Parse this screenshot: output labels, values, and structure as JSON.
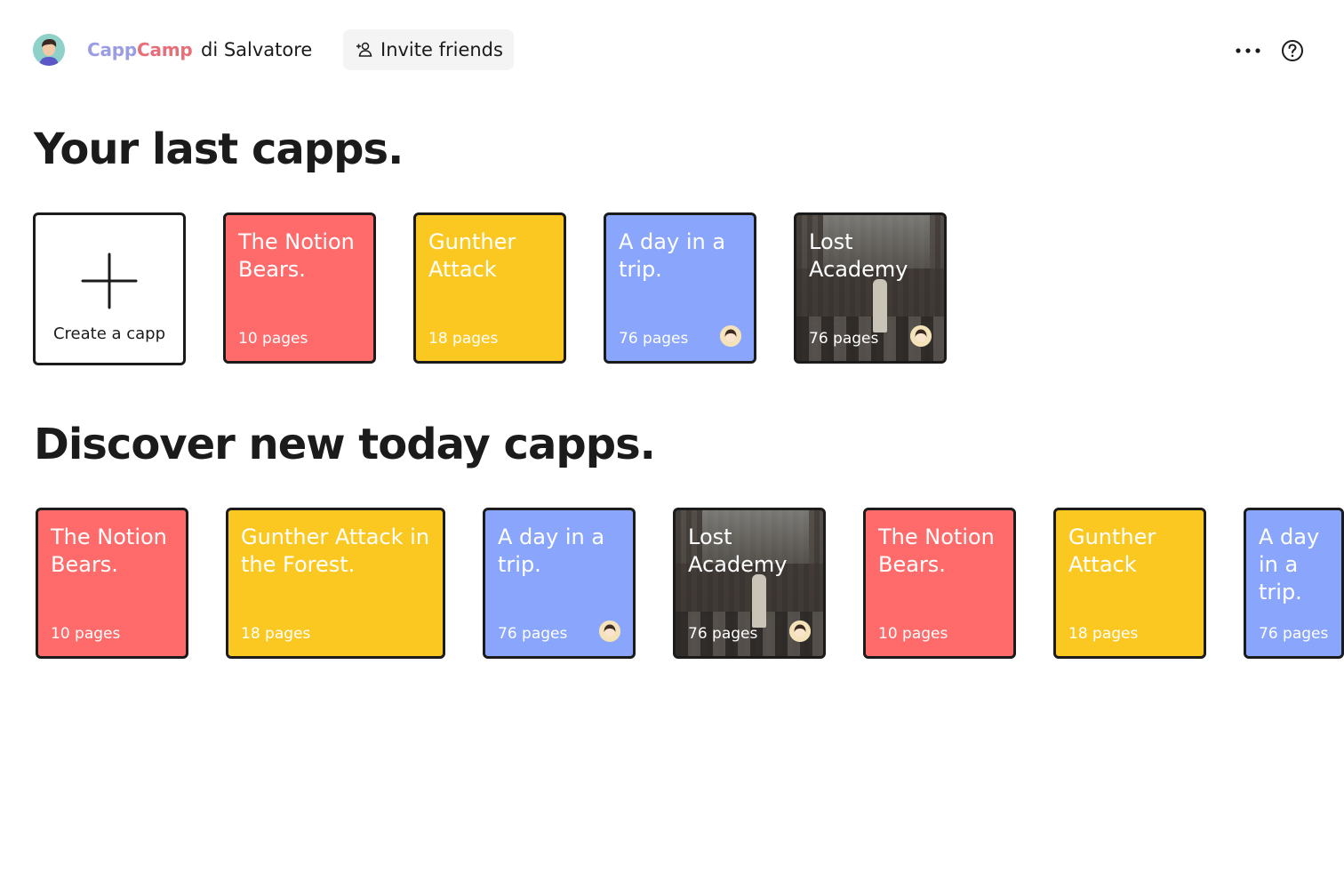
{
  "header": {
    "brand_part1": "Capp",
    "brand_part2": "Camp",
    "owner": "di Salvatore",
    "invite_label": "Invite friends"
  },
  "sections": {
    "last_title": "Your last capps.",
    "discover_title": "Discover new today capps."
  },
  "create_label": "Create a capp",
  "last_capps": [
    {
      "title": "The Notion Bears.",
      "pages": "10 pages",
      "style": "red",
      "has_avatar": false
    },
    {
      "title": "Gunther Attack",
      "pages": "18 pages",
      "style": "yellow",
      "has_avatar": false
    },
    {
      "title": "A day in a trip.",
      "pages": "76 pages",
      "style": "blue",
      "has_avatar": true
    },
    {
      "title": "Lost Academy",
      "pages": "76 pages",
      "style": "photo",
      "has_avatar": true
    }
  ],
  "discover_capps": [
    {
      "title": "The Notion Bears.",
      "pages": "10 pages",
      "style": "red",
      "has_avatar": false
    },
    {
      "title": "Gunther Attack in the Forest.",
      "pages": "18 pages",
      "style": "yellow",
      "has_avatar": false
    },
    {
      "title": "A day in a trip.",
      "pages": "76 pages",
      "style": "blue",
      "has_avatar": true
    },
    {
      "title": "Lost Academy",
      "pages": "76 pages",
      "style": "photo",
      "has_avatar": true
    },
    {
      "title": "The Notion Bears.",
      "pages": "10 pages",
      "style": "red",
      "has_avatar": false
    },
    {
      "title": "Gunther Attack",
      "pages": "18 pages",
      "style": "yellow",
      "has_avatar": false
    },
    {
      "title": "A day in a trip.",
      "pages": "76 pages",
      "style": "blue",
      "has_avatar": false
    }
  ],
  "colors": {
    "red": "#ff6b6b",
    "yellow": "#fbc822",
    "blue": "#8aa5fc",
    "text": "#1b1b1b"
  },
  "icons": {
    "invite": "add-person-icon",
    "more": "more-horizontal-icon",
    "help": "help-circle-icon",
    "create": "plus-icon"
  }
}
